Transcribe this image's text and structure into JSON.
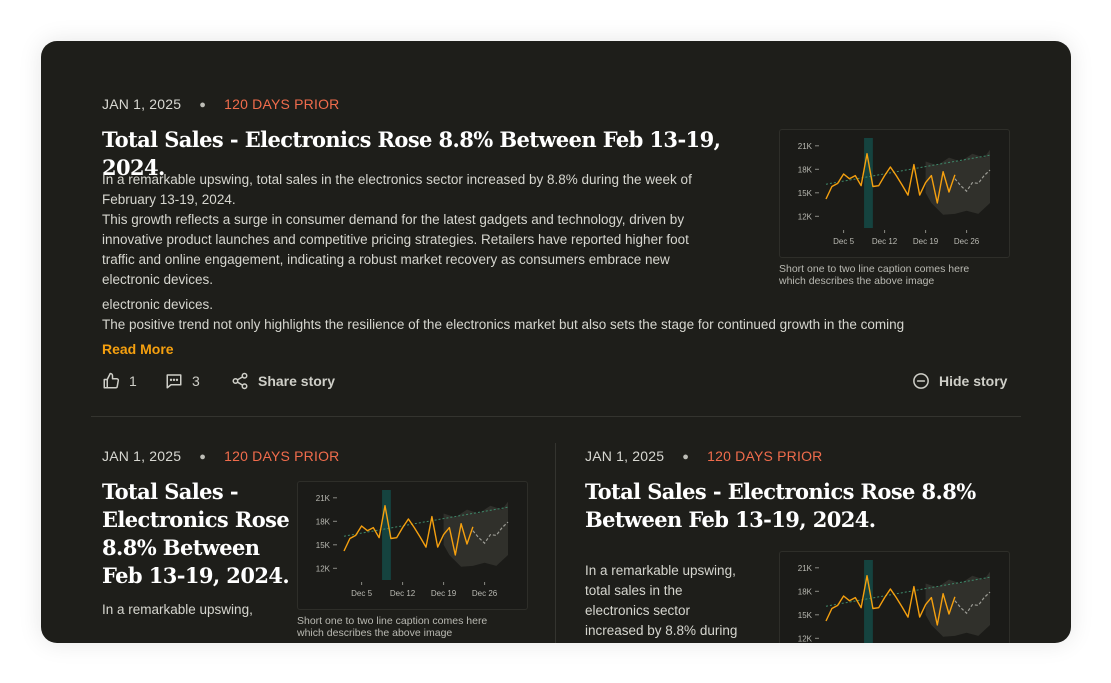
{
  "colors": {
    "background": "#1e1e1a",
    "accent_orange": "#f5a00f",
    "prior_red": "#f06c4c",
    "chart_line": "#f5a00f",
    "highlight_band": "#15433f",
    "trend": "#3e8a6b"
  },
  "story_main": {
    "date": "JAN 1, 2025",
    "prior": "120 DAYS PRIOR",
    "title": "Total Sales - Electronics Rose 8.8% Between Feb 13-19, 2024.",
    "body_lines": [
      "In a remarkable upswing, total sales in the electronics sector increased by 8.8% during the week of",
      "February 13-19, 2024.",
      "This growth reflects a surge in consumer demand for the latest gadgets and technology, driven by",
      "innovative product launches and competitive pricing strategies. Retailers have reported higher foot",
      "traffic and online engagement, indicating a robust market recovery as consumers embrace new",
      "electronic devices."
    ],
    "body_continued_lines": [
      "electronic devices.",
      "The positive trend not only highlights the resilience of the electronics market but also sets the stage for continued growth in the coming"
    ],
    "read_more": "Read More",
    "likes": "1",
    "comments": "3",
    "share_label": "Share story",
    "hide_label": "Hide story",
    "caption_lines": [
      "Short one to two line caption comes here",
      "which describes the above image"
    ]
  },
  "story_left": {
    "date": "JAN 1, 2025",
    "prior": "120 DAYS PRIOR",
    "title_lines": [
      "Total Sales -",
      "Electronics Rose",
      "8.8% Between",
      "Feb 13-19, 2024."
    ],
    "body": "In a remarkable upswing,",
    "caption_lines": [
      "Short one to two line caption comes here",
      "which describes the above image"
    ]
  },
  "story_right": {
    "date": "JAN 1, 2025",
    "prior": "120 DAYS PRIOR",
    "title_lines": [
      "Total Sales - Electronics Rose 8.8%",
      "Between Feb 13-19, 2024."
    ],
    "body_lines": [
      "In a remarkable upswing,",
      "total sales in the",
      "electronics sector",
      "increased by 8.8% during"
    ]
  },
  "chart_data": {
    "type": "line",
    "y_ticks": [
      "21K",
      "18K",
      "15K",
      "12K"
    ],
    "x_ticks": [
      "Dec 5",
      "Dec 12",
      "Dec 19",
      "Dec 26"
    ],
    "ylim": [
      10500,
      22000
    ],
    "highlight_range": [
      "Dec 8",
      "Dec 9"
    ],
    "series": [
      {
        "values": [
          [
            0,
            14200
          ],
          [
            1,
            15800
          ],
          [
            2,
            16200
          ],
          [
            3,
            17400
          ],
          [
            4,
            16800
          ],
          [
            5,
            17200
          ],
          [
            6,
            15900
          ],
          [
            7,
            20000
          ],
          [
            8,
            15800
          ],
          [
            9,
            15900
          ],
          [
            10,
            17200
          ],
          [
            11,
            18300
          ],
          [
            12,
            17200
          ],
          [
            13,
            16000
          ],
          [
            14,
            14700
          ],
          [
            15,
            18600
          ],
          [
            16,
            14700
          ],
          [
            17,
            16300
          ],
          [
            18,
            17200
          ],
          [
            19,
            13700
          ],
          [
            20,
            17700
          ],
          [
            21,
            15100
          ],
          [
            22,
            17300
          ]
        ]
      },
      {
        "values": [
          [
            22,
            16800
          ],
          [
            23,
            15900
          ],
          [
            24,
            15200
          ],
          [
            25,
            16300
          ],
          [
            26,
            16200
          ],
          [
            27,
            17200
          ],
          [
            28,
            17900
          ]
        ]
      },
      {
        "values": [
          [
            0,
            16100
          ],
          [
            28,
            19800
          ]
        ]
      }
    ],
    "forecast_band": {
      "upper": [
        [
          17,
          19000
        ],
        [
          19,
          18500
        ],
        [
          21,
          19500
        ],
        [
          23,
          19000
        ],
        [
          25,
          20000
        ],
        [
          27,
          19500
        ],
        [
          28,
          20500
        ]
      ],
      "lower": [
        [
          28,
          13700
        ],
        [
          26,
          12300
        ],
        [
          24,
          12700
        ],
        [
          22,
          12300
        ],
        [
          20,
          12200
        ],
        [
          18,
          13700
        ],
        [
          17,
          15000
        ]
      ]
    }
  }
}
